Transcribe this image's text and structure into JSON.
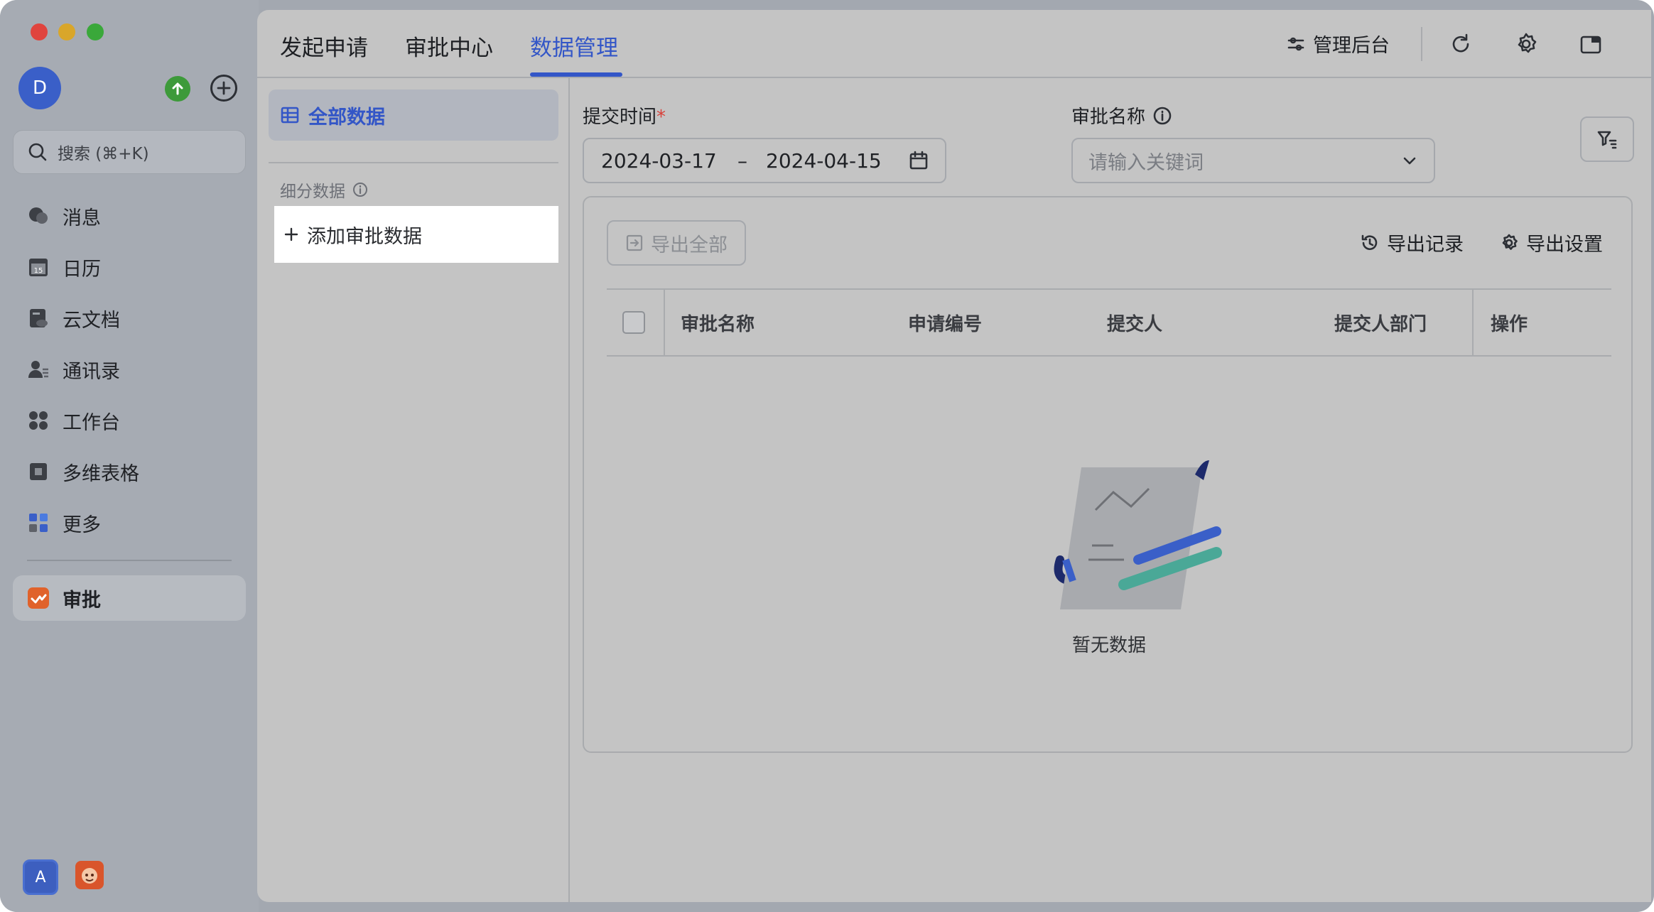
{
  "sidebar": {
    "avatar_letter": "D",
    "search_placeholder": "搜索 (⌘+K)",
    "items": [
      {
        "label": "消息",
        "icon": "chat-bubble-icon"
      },
      {
        "label": "日历",
        "icon": "calendar-icon",
        "badge": "15"
      },
      {
        "label": "云文档",
        "icon": "cloud-doc-icon"
      },
      {
        "label": "通讯录",
        "icon": "contacts-icon"
      },
      {
        "label": "工作台",
        "icon": "workspace-grid-icon"
      },
      {
        "label": "多维表格",
        "icon": "base-table-icon"
      },
      {
        "label": "更多",
        "icon": "more-apps-icon"
      }
    ],
    "active_app": {
      "label": "审批",
      "icon": "approval-app-icon"
    },
    "bottom": {
      "account_letter": "A"
    }
  },
  "header": {
    "tabs": [
      {
        "label": "发起申请",
        "active": false
      },
      {
        "label": "审批中心",
        "active": false
      },
      {
        "label": "数据管理",
        "active": true
      }
    ],
    "admin_label": "管理后台"
  },
  "subnav": {
    "all_data": "全部数据",
    "section_label": "细分数据",
    "add_label": "添加审批数据"
  },
  "filters": {
    "time_label": "提交时间",
    "required_mark": "*",
    "start_date": "2024-03-17",
    "range_separator": "–",
    "end_date": "2024-04-15",
    "name_label": "审批名称",
    "name_placeholder": "请输入关键词"
  },
  "toolbar": {
    "export_all": "导出全部",
    "export_records": "导出记录",
    "export_settings": "导出设置"
  },
  "table": {
    "columns": [
      "审批名称",
      "申请编号",
      "提交人",
      "提交人部门",
      "操作"
    ],
    "rows": [],
    "empty_text": "暂无数据"
  },
  "colors": {
    "accent": "#3356c7",
    "required": "#d8413a",
    "window_bg": "#a3a8b0",
    "panel_bg": "#c4c4c4"
  }
}
